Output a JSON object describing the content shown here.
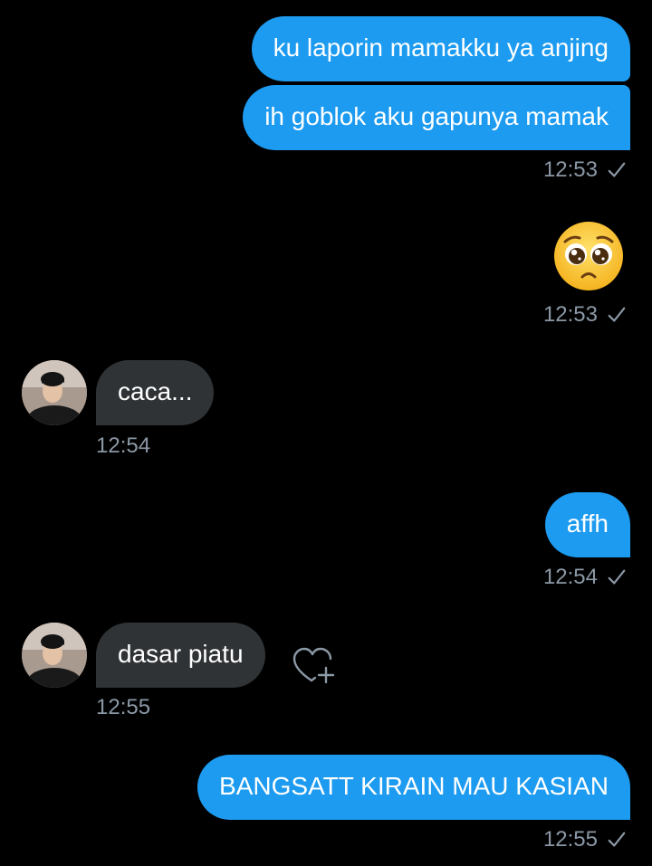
{
  "messages": [
    {
      "side": "sent",
      "text": "ku laporin mamakku ya anjing"
    },
    {
      "side": "sent",
      "text": "ih goblok aku gapunya mamak",
      "time": "12:53"
    },
    {
      "side": "sent",
      "emoji": "pleading-face",
      "time": "12:53"
    },
    {
      "side": "received",
      "text": "caca...",
      "time": "12:54"
    },
    {
      "side": "sent",
      "text": "affh",
      "time": "12:54"
    },
    {
      "side": "received",
      "text": "dasar piatu",
      "time": "12:55"
    },
    {
      "side": "sent",
      "text": "BANGSATT KIRAIN MAU KASIAN",
      "time": "12:55"
    }
  ],
  "icons": {
    "read_receipt": "checkmark-icon",
    "react": "heart-plus-icon",
    "emoji": "pleading-face-icon"
  },
  "colors": {
    "background": "#000000",
    "sent_bubble": "#1d9bf0",
    "received_bubble": "#2f3336",
    "timestamp": "#8b98a5"
  }
}
